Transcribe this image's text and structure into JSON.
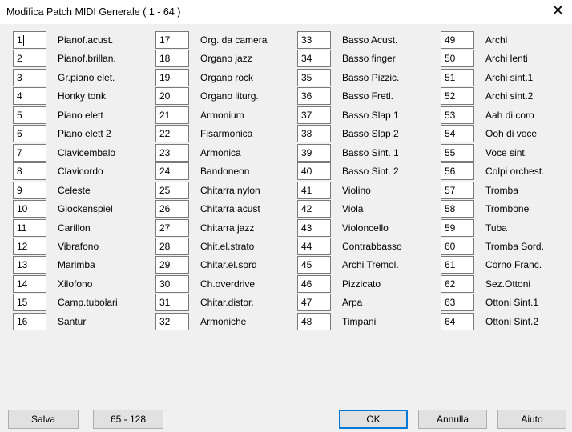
{
  "window": {
    "title": "Modifica Patch MIDI Generale ( 1 - 64 )",
    "close_glyph": "✕"
  },
  "patches": [
    {
      "num": "1",
      "name": "Pianof.acust."
    },
    {
      "num": "2",
      "name": "Pianof.brillan."
    },
    {
      "num": "3",
      "name": "Gr.piano elet."
    },
    {
      "num": "4",
      "name": "Honky tonk"
    },
    {
      "num": "5",
      "name": "Piano elett"
    },
    {
      "num": "6",
      "name": "Piano elett 2"
    },
    {
      "num": "7",
      "name": "Clavicembalo"
    },
    {
      "num": "8",
      "name": "Clavicordo"
    },
    {
      "num": "9",
      "name": "Celeste"
    },
    {
      "num": "10",
      "name": "Glockenspiel"
    },
    {
      "num": "11",
      "name": "Carillon"
    },
    {
      "num": "12",
      "name": "Vibrafono"
    },
    {
      "num": "13",
      "name": "Marimba"
    },
    {
      "num": "14",
      "name": "Xilofono"
    },
    {
      "num": "15",
      "name": "Camp.tubolari"
    },
    {
      "num": "16",
      "name": "Santur"
    },
    {
      "num": "17",
      "name": "Org. da camera"
    },
    {
      "num": "18",
      "name": "Organo jazz"
    },
    {
      "num": "19",
      "name": "Organo rock"
    },
    {
      "num": "20",
      "name": "Organo liturg."
    },
    {
      "num": "21",
      "name": "Armonium"
    },
    {
      "num": "22",
      "name": "Fisarmonica"
    },
    {
      "num": "23",
      "name": "Armonica"
    },
    {
      "num": "24",
      "name": "Bandoneon"
    },
    {
      "num": "25",
      "name": "Chitarra nylon"
    },
    {
      "num": "26",
      "name": "Chitarra acust"
    },
    {
      "num": "27",
      "name": "Chitarra jazz"
    },
    {
      "num": "28",
      "name": "Chit.el.strato"
    },
    {
      "num": "29",
      "name": "Chitar.el.sord"
    },
    {
      "num": "30",
      "name": "Ch.overdrive"
    },
    {
      "num": "31",
      "name": "Chitar.distor."
    },
    {
      "num": "32",
      "name": "Armoniche"
    },
    {
      "num": "33",
      "name": "Basso Acust."
    },
    {
      "num": "34",
      "name": "Basso finger"
    },
    {
      "num": "35",
      "name": "Basso Pizzic."
    },
    {
      "num": "36",
      "name": "Basso Fretl."
    },
    {
      "num": "37",
      "name": "Basso Slap 1"
    },
    {
      "num": "38",
      "name": "Basso Slap 2"
    },
    {
      "num": "39",
      "name": "Basso Sint. 1"
    },
    {
      "num": "40",
      "name": "Basso Sint. 2"
    },
    {
      "num": "41",
      "name": "Violino"
    },
    {
      "num": "42",
      "name": "Viola"
    },
    {
      "num": "43",
      "name": "Violoncello"
    },
    {
      "num": "44",
      "name": "Contrabbasso"
    },
    {
      "num": "45",
      "name": "Archi Tremol."
    },
    {
      "num": "46",
      "name": "Pizzicato"
    },
    {
      "num": "47",
      "name": "Arpa"
    },
    {
      "num": "48",
      "name": "Timpani"
    },
    {
      "num": "49",
      "name": "Archi"
    },
    {
      "num": "50",
      "name": "Archi lenti"
    },
    {
      "num": "51",
      "name": "Archi sint.1"
    },
    {
      "num": "52",
      "name": "Archi sint.2"
    },
    {
      "num": "53",
      "name": "Aah di coro"
    },
    {
      "num": "54",
      "name": "Ooh di voce"
    },
    {
      "num": "55",
      "name": "Voce sint."
    },
    {
      "num": "56",
      "name": "Colpi orchest."
    },
    {
      "num": "57",
      "name": "Tromba"
    },
    {
      "num": "58",
      "name": "Trombone"
    },
    {
      "num": "59",
      "name": "Tuba"
    },
    {
      "num": "60",
      "name": "Tromba Sord."
    },
    {
      "num": "61",
      "name": "Corno Franc."
    },
    {
      "num": "62",
      "name": "Sez.Ottoni"
    },
    {
      "num": "63",
      "name": "Ottoni Sint.1"
    },
    {
      "num": "64",
      "name": "Ottoni Sint.2"
    }
  ],
  "buttons": {
    "save": "Salva",
    "range": "65 - 128",
    "ok": "OK",
    "cancel": "Annulla",
    "help": "Aiuto"
  },
  "colors": {
    "focus_border": "#0078d7",
    "dialog_bg": "#f0f0f0"
  }
}
